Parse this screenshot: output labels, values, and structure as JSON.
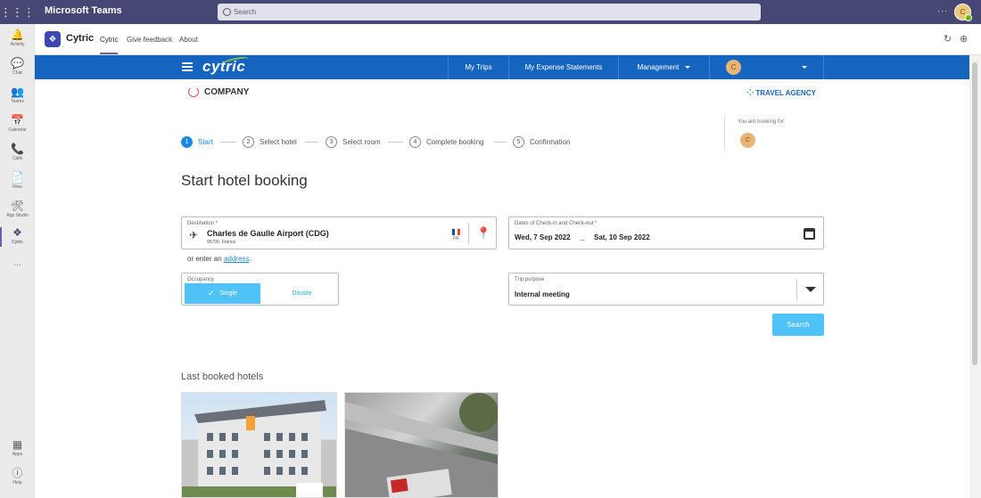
{
  "teams": {
    "title": "Microsoft Teams",
    "search_placeholder": "Search",
    "more": "···",
    "avatar_initials": "C"
  },
  "rail": {
    "items": [
      {
        "label": "Activity",
        "icon": "bell-icon",
        "glyph": "🔔"
      },
      {
        "label": "Chat",
        "icon": "chat-icon",
        "glyph": "💬"
      },
      {
        "label": "Teams",
        "icon": "teams-icon",
        "glyph": "👥"
      },
      {
        "label": "Calendar",
        "icon": "calendar-icon",
        "glyph": "📅"
      },
      {
        "label": "Calls",
        "icon": "phone-icon",
        "glyph": "📞"
      },
      {
        "label": "Files",
        "icon": "file-icon",
        "glyph": "📄"
      },
      {
        "label": "App Studio",
        "icon": "app-studio-icon",
        "glyph": "🛠"
      },
      {
        "label": "Cytric",
        "icon": "cytric-icon",
        "glyph": "❖"
      }
    ],
    "more": "···",
    "apps_label": "Apps",
    "help_label": "Help"
  },
  "app_header": {
    "app_name": "Cytric",
    "tabs": [
      "Cytric",
      "Give feedback",
      "About"
    ]
  },
  "cytric_nav": {
    "logo_text": "cytric",
    "items": [
      "My Trips",
      "My Expense Statements",
      "Management"
    ],
    "avatar_initials": "C"
  },
  "branding": {
    "company": "COMPANY",
    "agency": "TRAVEL AGENCY"
  },
  "booking_for": {
    "label": "You are booking for:",
    "avatar_initials": "C"
  },
  "steps": [
    {
      "num": "1",
      "label": "Start",
      "active": true
    },
    {
      "num": "2",
      "label": "Select hotel",
      "active": false
    },
    {
      "num": "3",
      "label": "Select room",
      "active": false
    },
    {
      "num": "4",
      "label": "Complete booking",
      "active": false
    },
    {
      "num": "5",
      "label": "Confirmation",
      "active": false
    }
  ],
  "page_title": "Start hotel booking",
  "destination": {
    "label": "Destination *",
    "name": "Charles de Gaulle Airport (CDG)",
    "sub": "95700, France",
    "country_code": "FR"
  },
  "or_enter": {
    "prefix": "or enter an",
    "link": "address",
    "suffix": "."
  },
  "dates": {
    "label": "Dates of Check-in and Check-out *",
    "checkin": "Wed, 7 Sep 2022",
    "separator": "_",
    "checkout": "Sat, 10 Sep 2022"
  },
  "occupancy": {
    "label": "Occupancy",
    "single": "Single",
    "double": "Double",
    "selected": "Single"
  },
  "trip_purpose": {
    "label": "Trip purpose",
    "value": "Internal meeting"
  },
  "search_button": "Search",
  "last_booked": {
    "title": "Last booked hotels"
  },
  "colors": {
    "teams_bar": "#464775",
    "cytric_nav": "#1565c0",
    "accent": "#4fc3f7",
    "step_active": "#1e88e5"
  }
}
